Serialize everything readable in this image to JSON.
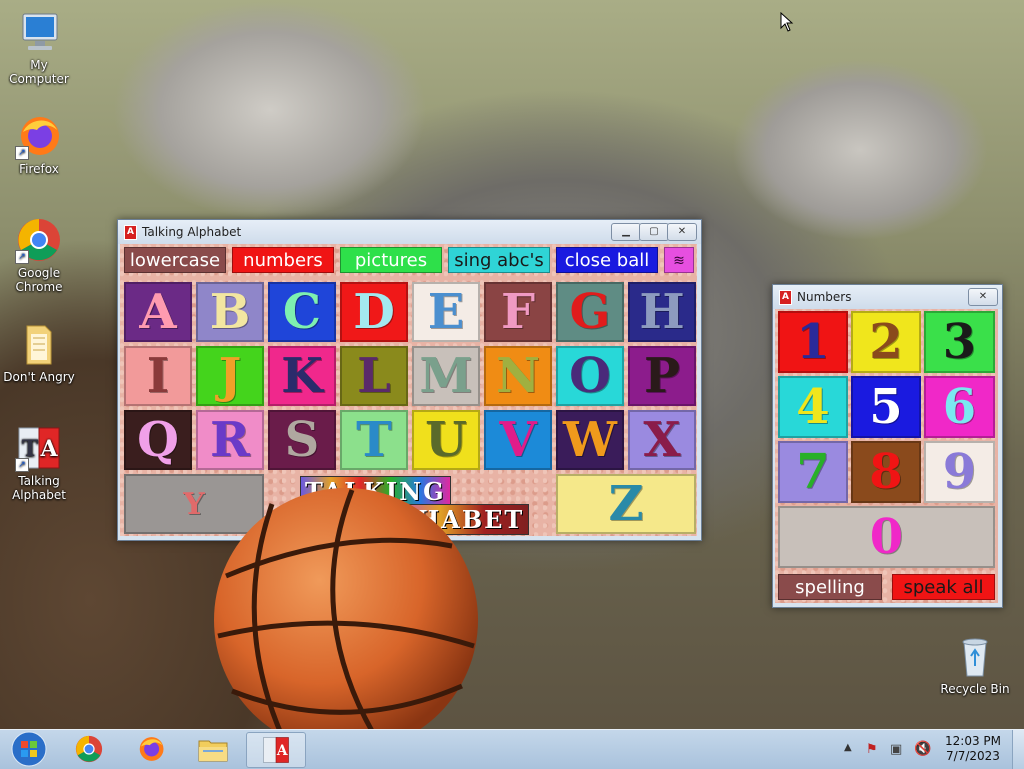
{
  "desktop": {
    "icons": [
      {
        "label": "My Computer"
      },
      {
        "label": "Firefox"
      },
      {
        "label": "Google Chrome"
      },
      {
        "label": "Don't Angry"
      },
      {
        "label": "Talking Alphabet"
      },
      {
        "label": "Recycle Bin"
      }
    ]
  },
  "alphabet_window": {
    "title": "Talking Alphabet",
    "buttons": {
      "lowercase": "lowercase",
      "numbers": "numbers",
      "pictures": "pictures",
      "sing": "sing abc's",
      "close_ball": "close ball"
    },
    "letters": [
      "A",
      "B",
      "C",
      "D",
      "E",
      "F",
      "G",
      "H",
      "I",
      "J",
      "K",
      "L",
      "M",
      "N",
      "O",
      "P",
      "Q",
      "R",
      "S",
      "T",
      "U",
      "V",
      "W",
      "X",
      "Y",
      "Z"
    ],
    "logo_text": [
      "TALKING",
      "ALPHABET"
    ]
  },
  "numbers_window": {
    "title": "Numbers",
    "digits": [
      "1",
      "2",
      "3",
      "4",
      "5",
      "6",
      "7",
      "8",
      "9",
      "0"
    ],
    "buttons": {
      "spelling": "spelling",
      "speak_all": "speak all"
    }
  },
  "taskbar": {
    "time": "12:03 PM",
    "date": "7/7/2023"
  }
}
